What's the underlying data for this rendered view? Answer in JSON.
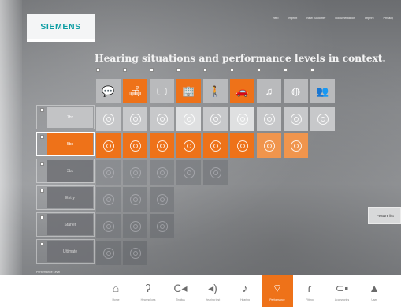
{
  "brand": {
    "logo": "SIEMENS"
  },
  "topnav": [
    "Help",
    "Imprint",
    "New customer",
    "Documentation",
    "Imprint",
    "Privacy"
  ],
  "headline": "Hearing situations and performance levels in context.",
  "situations": [
    {
      "icon": "speech-bubble-icon",
      "glyph": "💬",
      "active": false
    },
    {
      "icon": "sofa-icon",
      "glyph": "🛋",
      "active": true
    },
    {
      "icon": "tv-icon",
      "glyph": "🖵",
      "active": false
    },
    {
      "icon": "building-icon",
      "glyph": "🏢",
      "active": true
    },
    {
      "icon": "outdoor-person-icon",
      "glyph": "🚶",
      "active": false
    },
    {
      "icon": "car-icon",
      "glyph": "🚗",
      "active": true
    },
    {
      "icon": "music-icon",
      "glyph": "♫",
      "active": false
    },
    {
      "icon": "ball-icon",
      "glyph": "◍",
      "active": false
    },
    {
      "icon": "group-icon",
      "glyph": "👥",
      "active": false
    }
  ],
  "levels": [
    {
      "label": "7bx",
      "style": "light",
      "cells": 9
    },
    {
      "label": "5bx",
      "style": "active",
      "cells": 8
    },
    {
      "label": "3bx",
      "style": "dark",
      "cells": 5
    },
    {
      "label": "Entry",
      "style": "dark",
      "cells": 3
    },
    {
      "label": "Starter",
      "style": "dark",
      "cells": 3
    },
    {
      "label": "Ultimate",
      "style": "dark",
      "cells": 2
    }
  ],
  "footnote": "Performance Level",
  "tooltip": "Feature list",
  "bottom_nav": [
    {
      "icon": "home-icon",
      "glyph": "⌂",
      "label": "Home",
      "active": false
    },
    {
      "icon": "ear-icon",
      "glyph": "ʔ",
      "label": "Hearing loss",
      "active": false
    },
    {
      "icon": "tinnitus-icon",
      "glyph": "C◂",
      "label": "Tinnitus",
      "active": false
    },
    {
      "icon": "hearing-test-icon",
      "glyph": "◂)",
      "label": "Hearing test",
      "active": false
    },
    {
      "icon": "hearing-aid-icon",
      "glyph": "♪",
      "label": "Hearing",
      "active": false
    },
    {
      "icon": "performance-icon",
      "glyph": "⌔",
      "label": "Performance",
      "active": true
    },
    {
      "icon": "fitting-icon",
      "glyph": "ɾ",
      "label": "Fitting",
      "active": false
    },
    {
      "icon": "accessories-icon",
      "glyph": "⊂▪",
      "label": "Accessories",
      "active": false
    },
    {
      "icon": "user-icon",
      "glyph": "▲",
      "label": "User",
      "active": false
    }
  ],
  "colors": {
    "accent": "#ee7219",
    "brand": "#0d9da3"
  }
}
